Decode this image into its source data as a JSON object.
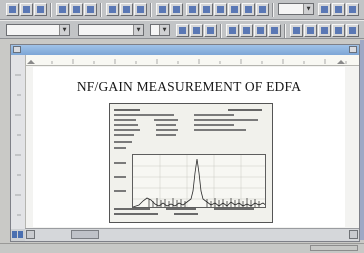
{
  "document": {
    "heading": "NF/GAIN MEASUREMENT OF EDFA"
  },
  "colors": {
    "title_bar": "#7da6d6",
    "toolbar": "#c2c4c6",
    "page": "#ffffff",
    "trace": "#2b2b2b"
  },
  "icons": {
    "toolbar_buttons": "generic-tool-icons",
    "spectrum": "optical-spectrum-trace"
  }
}
